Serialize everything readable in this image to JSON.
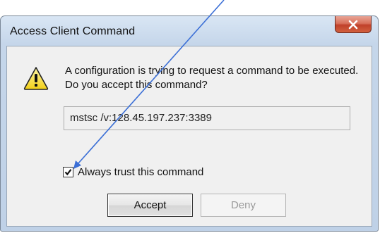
{
  "dialog": {
    "title": "Access Client Command",
    "message": "A configuration is trying to request a command to be executed. Do you accept this command?",
    "command": "mstsc /v:128.45.197.237:3389",
    "checkbox_label": "Always trust this command",
    "checkbox_checked": true,
    "accept_label": "Accept",
    "deny_label": "Deny",
    "deny_enabled": false
  },
  "icons": {
    "warning": "warning-icon",
    "close": "close-icon",
    "checkmark": "checkmark-icon"
  },
  "annotation": {
    "arrow_color": "#3b6fd6"
  }
}
